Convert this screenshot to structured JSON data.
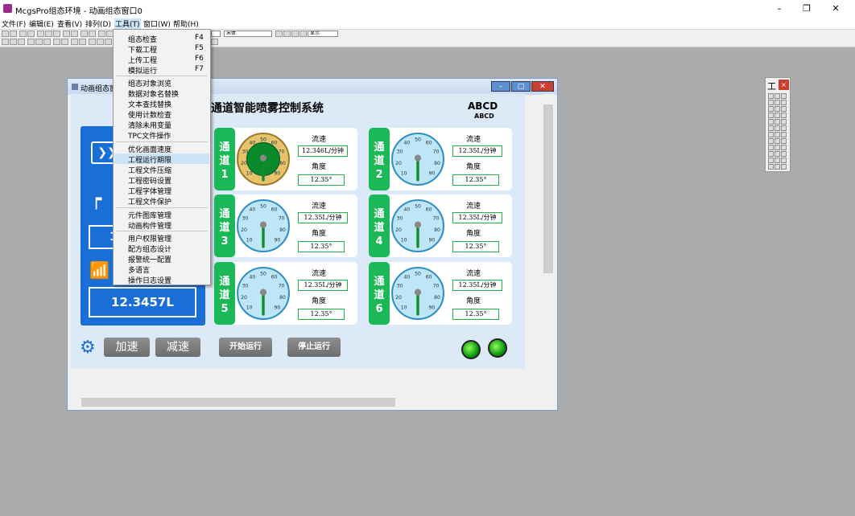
{
  "app": {
    "title": "McgsPro组态环境 - 动画组态窗口0"
  },
  "window_controls": {
    "minimize": "–",
    "maximize": "❐",
    "close": "✕"
  },
  "menubar": [
    {
      "label": "文件(F)"
    },
    {
      "label": "编辑(E)"
    },
    {
      "label": "查看(V)"
    },
    {
      "label": "排列(D)"
    },
    {
      "label": "工具(T)"
    },
    {
      "label": "窗口(W)"
    },
    {
      "label": "帮助(H)"
    }
  ],
  "toolbar": {
    "font_combo": "宋体",
    "size_combo": "",
    "style_combo": "显示"
  },
  "tools_menu": [
    {
      "label": "组态检查",
      "key": "F4"
    },
    {
      "label": "下载工程",
      "key": "F5"
    },
    {
      "label": "上传工程",
      "key": "F6"
    },
    {
      "label": "模拟运行",
      "key": "F7"
    },
    {
      "label": "组态对象浏览",
      "key": ""
    },
    {
      "label": "数据对象名替换",
      "key": ""
    },
    {
      "label": "文本查找替换",
      "key": ""
    },
    {
      "label": "使用计数检查",
      "key": ""
    },
    {
      "label": "清除未用变量",
      "key": ""
    },
    {
      "label": "TPC文件操作",
      "key": ""
    },
    {
      "label": "优化画面速度",
      "key": ""
    },
    {
      "label": "工程运行期限",
      "key": ""
    },
    {
      "label": "工程文件压缩",
      "key": ""
    },
    {
      "label": "工程密码设置",
      "key": ""
    },
    {
      "label": "工程字体管理",
      "key": ""
    },
    {
      "label": "工程文件保护",
      "key": ""
    },
    {
      "label": "元件图库管理",
      "key": ""
    },
    {
      "label": "动画构件管理",
      "key": ""
    },
    {
      "label": "用户权限管理",
      "key": ""
    },
    {
      "label": "配方组态设计",
      "key": ""
    },
    {
      "label": "报警统一配置",
      "key": ""
    },
    {
      "label": "多语言",
      "key": ""
    },
    {
      "label": "操作日志设置",
      "key": ""
    }
  ],
  "child_window": {
    "title": "动画组态窗口0"
  },
  "screen": {
    "title": "通道智能喷雾控制系统",
    "brand_top": "ABCD",
    "brand_sub": "ABCD",
    "left_value": "1",
    "total": "12.3457L",
    "flow_label": "流速",
    "angle_label": "角度",
    "channels": [
      {
        "tag": [
          "通",
          "道",
          "1"
        ],
        "flow": "12.346L/分钟",
        "angle": "12.35°",
        "highlighted": true
      },
      {
        "tag": [
          "通",
          "道",
          "2"
        ],
        "flow": "12.35L/分钟",
        "angle": "12.35°",
        "highlighted": false
      },
      {
        "tag": [
          "通",
          "道",
          "3"
        ],
        "flow": "12.35L/分钟",
        "angle": "12.35°",
        "highlighted": false
      },
      {
        "tag": [
          "通",
          "道",
          "4"
        ],
        "flow": "12.35L/分钟",
        "angle": "12.35°",
        "highlighted": false
      },
      {
        "tag": [
          "通",
          "道",
          "5"
        ],
        "flow": "12.35L/分钟",
        "angle": "12.35°",
        "highlighted": false
      },
      {
        "tag": [
          "通",
          "道",
          "6"
        ],
        "flow": "12.35L/分钟",
        "angle": "12.35°",
        "highlighted": false
      }
    ],
    "gauge_ticks": [
      "10",
      "20",
      "30",
      "40",
      "50",
      "60",
      "70",
      "80",
      "90"
    ],
    "buttons": {
      "speed_up": "加速",
      "slow_down": "减速",
      "start": "开始运行",
      "stop": "停止运行"
    }
  },
  "toolbox": {
    "title": "工",
    "close": "×"
  },
  "colors": {
    "accent_blue": "#1a6fd6",
    "accent_green": "#1ab856",
    "menu_highlight": "#cce4f7"
  }
}
